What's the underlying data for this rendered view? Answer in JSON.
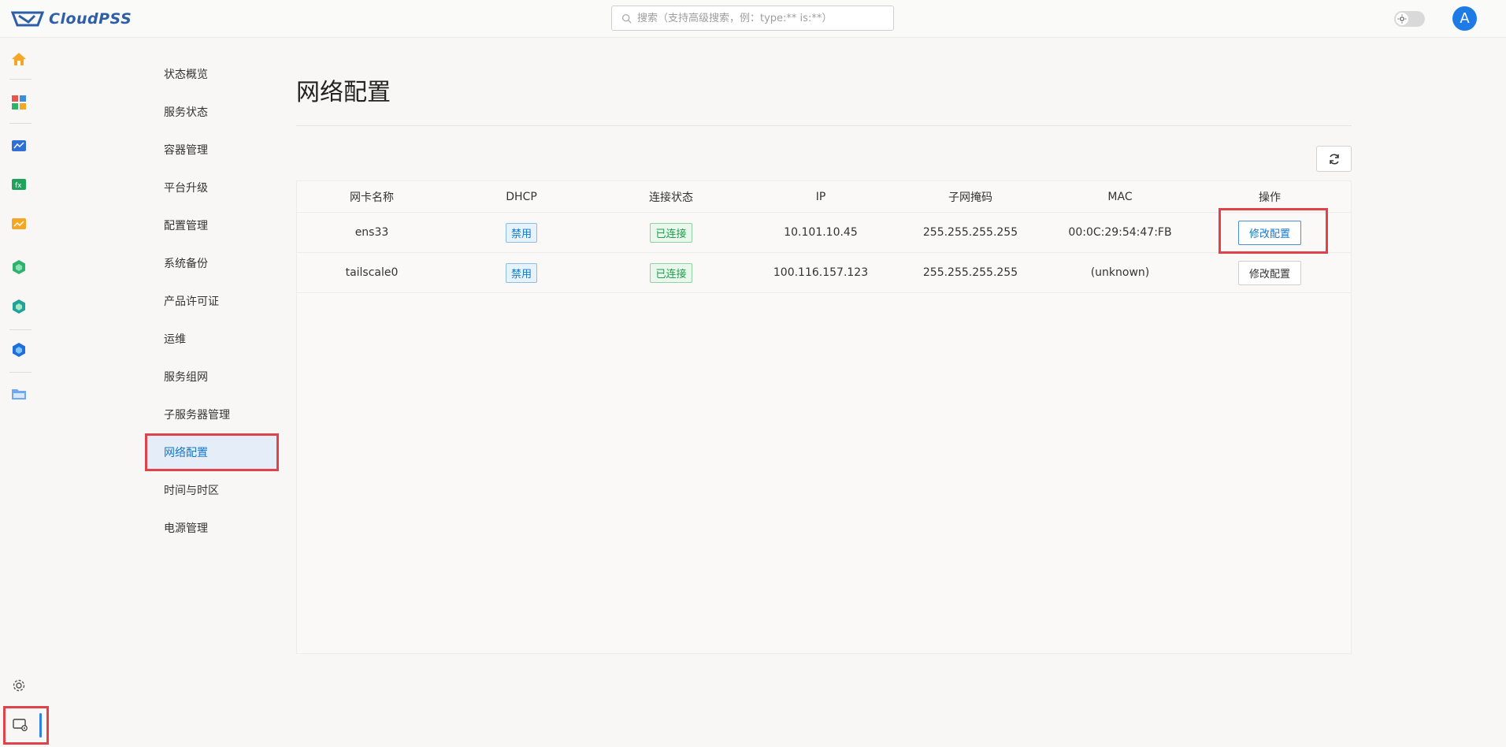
{
  "header": {
    "logo_text": "CloudPSS",
    "search_placeholder": "搜索（支持高级搜索，例：type:** is:**）",
    "avatar_letter": "A"
  },
  "rail": {
    "icons": [
      "home-icon",
      "apps-icon",
      "monitor-icon",
      "function-icon",
      "chart-icon",
      "hexagon-green-icon",
      "hexagon-teal-icon",
      "hexagon-blue-icon",
      "folder-icon",
      "settings-icon",
      "system-admin-icon"
    ]
  },
  "menu": {
    "items": [
      "状态概览",
      "服务状态",
      "容器管理",
      "平台升级",
      "配置管理",
      "系统备份",
      "产品许可证",
      "运维",
      "服务组网",
      "子服务器管理",
      "网络配置",
      "时间与时区",
      "电源管理"
    ],
    "active_index": 10
  },
  "page": {
    "title": "网络配置"
  },
  "table": {
    "headers": [
      "网卡名称",
      "DHCP",
      "连接状态",
      "IP",
      "子网掩码",
      "MAC",
      "操作"
    ],
    "rows": [
      {
        "name": "ens33",
        "dhcp": "禁用",
        "status": "已连接",
        "ip": "10.101.10.45",
        "mask": "255.255.255.255",
        "mac": "00:0C:29:54:47:FB",
        "action": "修改配置"
      },
      {
        "name": "tailscale0",
        "dhcp": "禁用",
        "status": "已连接",
        "ip": "100.116.157.123",
        "mask": "255.255.255.255",
        "mac": "(unknown)",
        "action": "修改配置"
      }
    ]
  },
  "colors": {
    "accent": "#1677c9",
    "highlight": "#e0424a",
    "success": "#1f9d4a"
  }
}
